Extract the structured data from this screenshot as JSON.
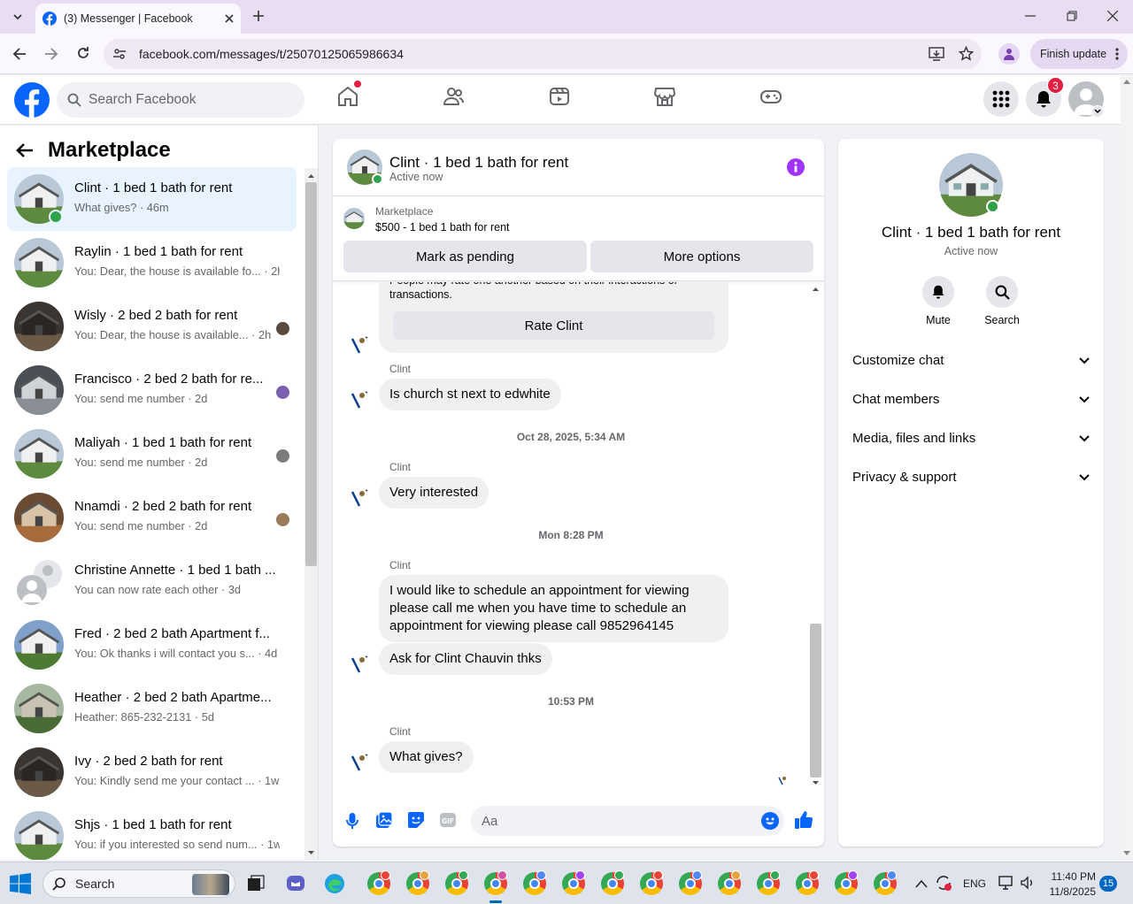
{
  "browser": {
    "tab_title": "(3) Messenger | Facebook",
    "url": "facebook.com/messages/t/25070125065986634",
    "finish_update": "Finish update"
  },
  "fb": {
    "search_placeholder": "Search Facebook",
    "notif_badge": "3",
    "colors": {
      "brand": "#0866ff",
      "badge": "#e41e3f",
      "online": "#31a24c",
      "info": "#a033ff"
    }
  },
  "left": {
    "title": "Marketplace",
    "conversations": [
      {
        "name": "Clint · 1 bed 1 bath for rent",
        "preview": "What gives? · 46m"
      },
      {
        "name": "Raylin · 1 bed 1 bath for rent",
        "preview": "You: Dear, the house is available fo... · 2h"
      },
      {
        "name": "Wisly · 2 bed 2 bath for rent",
        "preview": "You: Dear, the house is available... · 2h"
      },
      {
        "name": "Francisco · 2 bed 2 bath for re...",
        "preview": "You: send me number · 2d"
      },
      {
        "name": "Maliyah · 1 bed 1 bath for rent",
        "preview": "You: send me number · 2d"
      },
      {
        "name": "Nnamdi · 2 bed 2 bath for rent",
        "preview": "You: send me number · 2d"
      },
      {
        "name": "Christine Annette · 1 bed 1 bath ...",
        "preview": "You can now rate each other · 3d"
      },
      {
        "name": "Fred · 2 bed 2 bath Apartment f...",
        "preview": "You: Ok thanks i will contact you s... · 4d"
      },
      {
        "name": "Heather · 2 bed 2 bath Apartme...",
        "preview": "Heather: 865-232-2131 · 5d"
      },
      {
        "name": "Ivy · 2 bed 2 bath for rent",
        "preview": "You: Kindly send me your contact ... · 1w"
      },
      {
        "name": "Shjs · 1 bed 1 bath for rent",
        "preview": "You: if you interested so send num... · 1w"
      }
    ]
  },
  "chat": {
    "name": "Clint · 1 bed 1 bath for rent",
    "status": "Active now",
    "listing_label": "Marketplace",
    "listing_title": "$500 - 1 bed 1 bath for rent",
    "mark_pending": "Mark as pending",
    "more_options": "More options",
    "rate_partial": "People may rate one another based on their interactions or transactions.",
    "rate_button": "Rate Clint",
    "sender": "Clint",
    "messages": [
      "Is church st next to edwhite",
      "Very interested",
      "I would like to schedule an appointment for viewing please call me when you have time to schedule an appointment for viewing please call 9852964145",
      "Ask for Clint Chauvin thks",
      "What gives?"
    ],
    "timestamps": [
      "Oct 28, 2025, 5:34 AM",
      "Mon 8:28 PM",
      "10:53 PM"
    ],
    "input_placeholder": "Aa"
  },
  "right": {
    "name": "Clint · 1 bed 1 bath for rent",
    "status": "Active now",
    "mute": "Mute",
    "search": "Search",
    "sections": [
      "Customize chat",
      "Chat members",
      "Media, files and links",
      "Privacy & support"
    ]
  },
  "taskbar": {
    "search": "Search",
    "lang": "ENG",
    "time": "11:40 PM",
    "date": "11/8/2025",
    "notif_count": "15"
  }
}
